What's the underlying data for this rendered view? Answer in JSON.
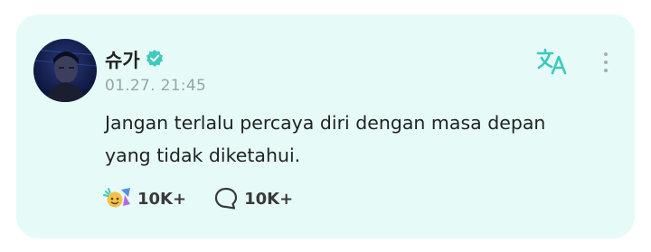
{
  "post": {
    "author_name": "슈가",
    "verified_icon": "verified-badge-icon",
    "timestamp": "01.27. 21:45",
    "body_lines": [
      "Jangan terlalu percaya diri dengan masa depan",
      "yang tidak diketahui."
    ]
  },
  "actions": {
    "reactions_count": "10K+",
    "comments_count": "10K+",
    "reaction_icon": "cheer-reaction-icon",
    "comment_icon": "comment-bubble-icon"
  },
  "toolbar": {
    "translate_icon": "translate-icon",
    "more_icon": "more-vertical-icon"
  },
  "colors": {
    "card_background": "#e6fbf8",
    "accent": "#3ec9bd",
    "text_primary": "#222222",
    "text_muted": "#9aa3a3"
  }
}
